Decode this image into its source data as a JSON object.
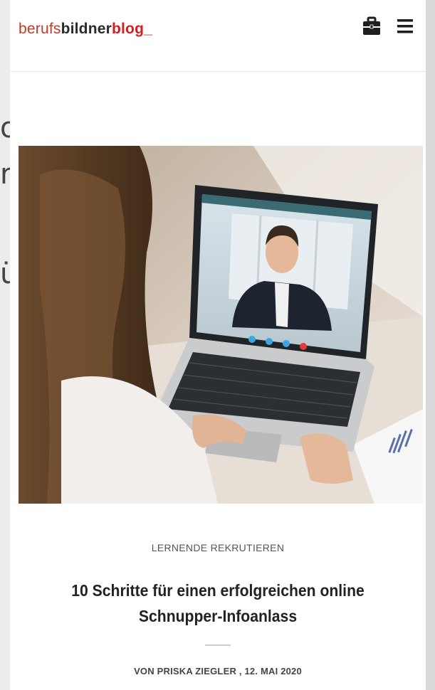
{
  "background_fragments": [
    "o",
    "rb",
    "",
    "ü"
  ],
  "header": {
    "logo": {
      "part1": "berufs",
      "part2": "bildner",
      "part3": "blog",
      "part4": "_"
    },
    "briefcase_icon": "briefcase-icon",
    "menu_icon": "hamburger-menu-icon"
  },
  "article": {
    "image_description_icon": "article-hero-image",
    "category": "LERNENDE REKRUTIEREN",
    "title_line1": "10 Schritte für einen erfolgreichen online",
    "title_line2": "Schnupper-Infoanlass",
    "byline": "VON PRISKA ZIEGLER , 12. MAI 2020"
  },
  "colors": {
    "brand_red": "#d61c1c",
    "text_dark": "#222222",
    "page_bg": "#d9d9d9"
  }
}
